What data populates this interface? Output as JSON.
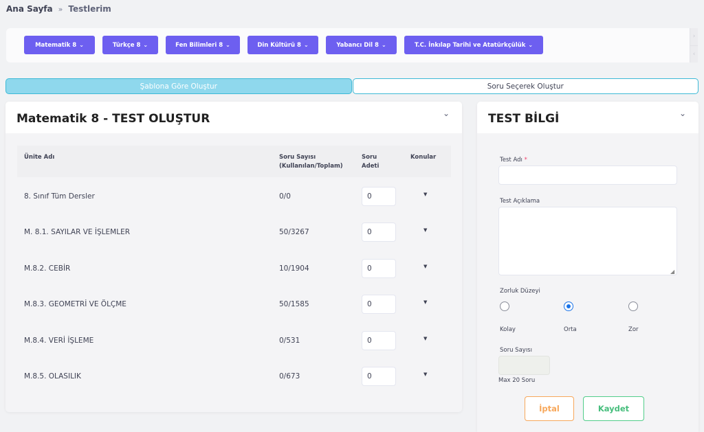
{
  "breadcrumb": {
    "home": "Ana Sayfa",
    "separator": "»",
    "current": "Testlerim"
  },
  "subjects": [
    {
      "label": "Matematik 8"
    },
    {
      "label": "Türkçe 8"
    },
    {
      "label": "Fen Bilimleri 8"
    },
    {
      "label": "Din Kültürü 8"
    },
    {
      "label": "Yabancı Dil 8"
    },
    {
      "label": "T.C. İnkılap Tarihi ve Atatürkçülük"
    }
  ],
  "subject_scroll": {
    "up": "›",
    "down": "‹"
  },
  "mode_tabs": {
    "template": "Şablona Göre Oluştur",
    "select": "Soru Seçerek Oluştur"
  },
  "test_card": {
    "title": "Matematik 8 - TEST OLUŞTUR",
    "columns": {
      "unit": "Ünite Adı",
      "count_line1": "Soru Sayısı",
      "count_line2": "(Kullanılan/Toplam)",
      "qty_line1": "Soru",
      "qty_line2": "Adeti",
      "topics": "Konular"
    },
    "rows": [
      {
        "name": "8. Sınıf Tüm Dersler",
        "count": "0/0",
        "qty": "0"
      },
      {
        "name": "M. 8.1. SAYILAR VE İŞLEMLER",
        "count": "50/3267",
        "qty": "0"
      },
      {
        "name": "M.8.2. CEBİR",
        "count": "10/1904",
        "qty": "0"
      },
      {
        "name": "M.8.3. GEOMETRİ VE ÖLÇME",
        "count": "50/1585",
        "qty": "0"
      },
      {
        "name": "M.8.4. VERİ İŞLEME",
        "count": "0/531",
        "qty": "0"
      },
      {
        "name": "M.8.5. OLASILIK",
        "count": "0/673",
        "qty": "0"
      }
    ]
  },
  "info_card": {
    "title": "TEST BİLGİ",
    "test_name_label": "Test Adı",
    "required_mark": "*",
    "test_name_value": "",
    "description_label": "Test Açıklama",
    "description_value": "",
    "difficulty_label": "Zorluk Düzeyi",
    "difficulty_options": [
      {
        "label": "Kolay",
        "checked": false
      },
      {
        "label": "Orta",
        "checked": true
      },
      {
        "label": "Zor",
        "checked": false
      }
    ],
    "question_count_label": "Soru Sayısı",
    "question_count_value": "",
    "max_note": "Max 20 Soru",
    "cancel_label": "İptal",
    "save_label": "Kaydet"
  },
  "colors": {
    "subject_button": "#6d5ff0",
    "active_tab": "#8fd8ed",
    "tab_border": "#3bb9d6",
    "cancel": "#f7a75a",
    "save": "#50cd89",
    "radio_checked": "#1a73e8"
  },
  "icons": {
    "chevron": "chevron-down-icon",
    "caret": "caret-down-icon",
    "separator": "double-chevron-right-icon"
  }
}
